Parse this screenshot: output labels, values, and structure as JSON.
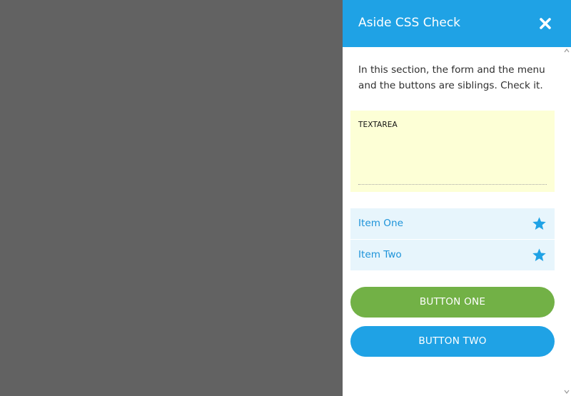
{
  "aside": {
    "title": "Aside CSS Check",
    "intro": "In this section, the form and the menu and the buttons are siblings. Check it.",
    "textarea_label": "TEXTAREA",
    "menu": [
      {
        "label": "Item One",
        "icon": "star-icon"
      },
      {
        "label": "Item Two",
        "icon": "star-icon"
      }
    ],
    "buttons": {
      "one": "BUTTON ONE",
      "two": "BUTTON TWO"
    }
  },
  "colors": {
    "backdrop": "#626262",
    "header": "#1fa2e5",
    "textarea_bg": "#fdffd6",
    "menu_bg": "#e7f5fc",
    "menu_text": "#1d93d9",
    "button_one": "#72b146",
    "button_two": "#1fa2e5"
  }
}
